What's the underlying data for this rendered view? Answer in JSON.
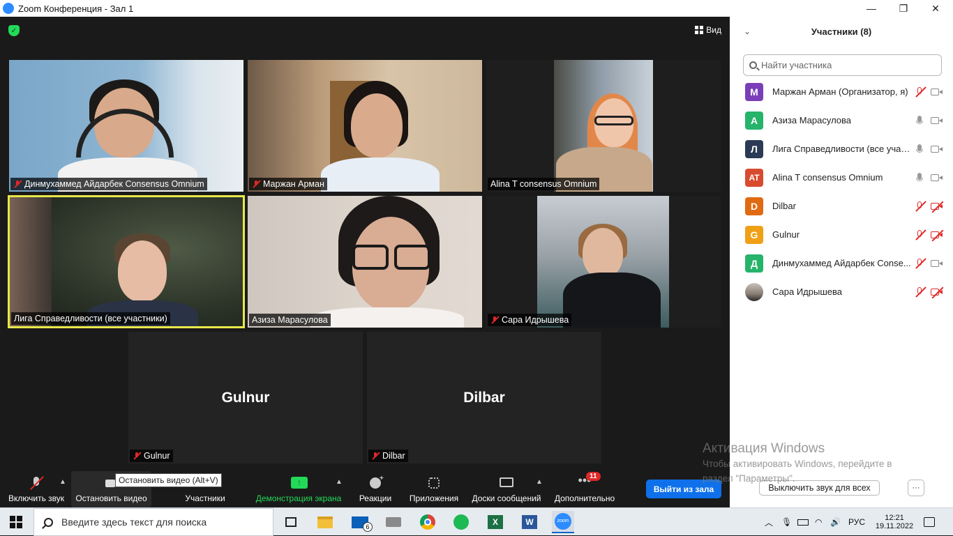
{
  "window": {
    "title": "Zoom Конференция - Зал 1",
    "minimize": "—",
    "maximize": "❐",
    "close": "✕"
  },
  "stage": {
    "view_label": "Вид"
  },
  "tiles": [
    {
      "name": "Динмухаммед Айдарбек Consensus Omnium",
      "muted": true
    },
    {
      "name": "Маржан Арман",
      "muted": true
    },
    {
      "name": "Alina T consensus Omnium",
      "muted": false
    },
    {
      "name": "Лига Справедливости (все участники)",
      "muted": false,
      "active_speaker": true
    },
    {
      "name": "Азиза Марасулова",
      "muted": false
    },
    {
      "name": "Сара Идрышева",
      "muted": true
    },
    {
      "name": "Gulnur",
      "muted": true,
      "video": false
    },
    {
      "name": "Dilbar",
      "muted": true,
      "video": false
    }
  ],
  "toolbar": {
    "unmute": "Включить звук",
    "stop_video": "Остановить видео",
    "stop_video_tooltip": "Остановить видео (Alt+V)",
    "participants": "Участники",
    "share_screen": "Демонстрация экрана",
    "reactions": "Реакции",
    "apps": "Приложения",
    "whiteboards": "Доски сообщений",
    "more": "Дополнительно",
    "more_badge": "11",
    "leave": "Выйти из зала"
  },
  "panel": {
    "title": "Участники (8)",
    "search_placeholder": "Найти участника",
    "participants": [
      {
        "initials": "M",
        "name": "Маржан Арман (Организатор, я)",
        "color": "#7a3fb8",
        "mic": "off",
        "cam": "on"
      },
      {
        "initials": "A",
        "name": "Азиза Марасулова",
        "color": "#26b36a",
        "mic": "on",
        "cam": "on"
      },
      {
        "initials": "Л",
        "name": "Лига Справедливости (все учас...",
        "color": "#2b3a55",
        "mic": "on",
        "cam": "on"
      },
      {
        "initials": "AT",
        "name": "Alina T consensus Omnium",
        "color": "#d84b2f",
        "mic": "on",
        "cam": "on"
      },
      {
        "initials": "D",
        "name": "Dilbar",
        "color": "#e06a12",
        "mic": "off",
        "cam": "off"
      },
      {
        "initials": "G",
        "name": "Gulnur",
        "color": "#f0a015",
        "mic": "off",
        "cam": "off"
      },
      {
        "initials": "Д",
        "name": "Динмухаммед Айдарбек Conse...",
        "color": "#26b36a",
        "mic": "off",
        "cam": "on"
      },
      {
        "initials": "",
        "name": "Сара Идрышева",
        "color": "#8a7f76",
        "mic": "off",
        "cam": "off"
      }
    ],
    "mute_all": "Выключить звук для всех",
    "more": "···"
  },
  "watermark": {
    "line1": "Активация Windows",
    "line2": "Чтобы активировать Windows, перейдите в раздел \"Параметры\"."
  },
  "taskbar": {
    "search_placeholder": "Введите здесь текст для поиска",
    "mail_badge": "6",
    "lang": "РУС",
    "time": "12:21",
    "date": "19.11.2022"
  }
}
